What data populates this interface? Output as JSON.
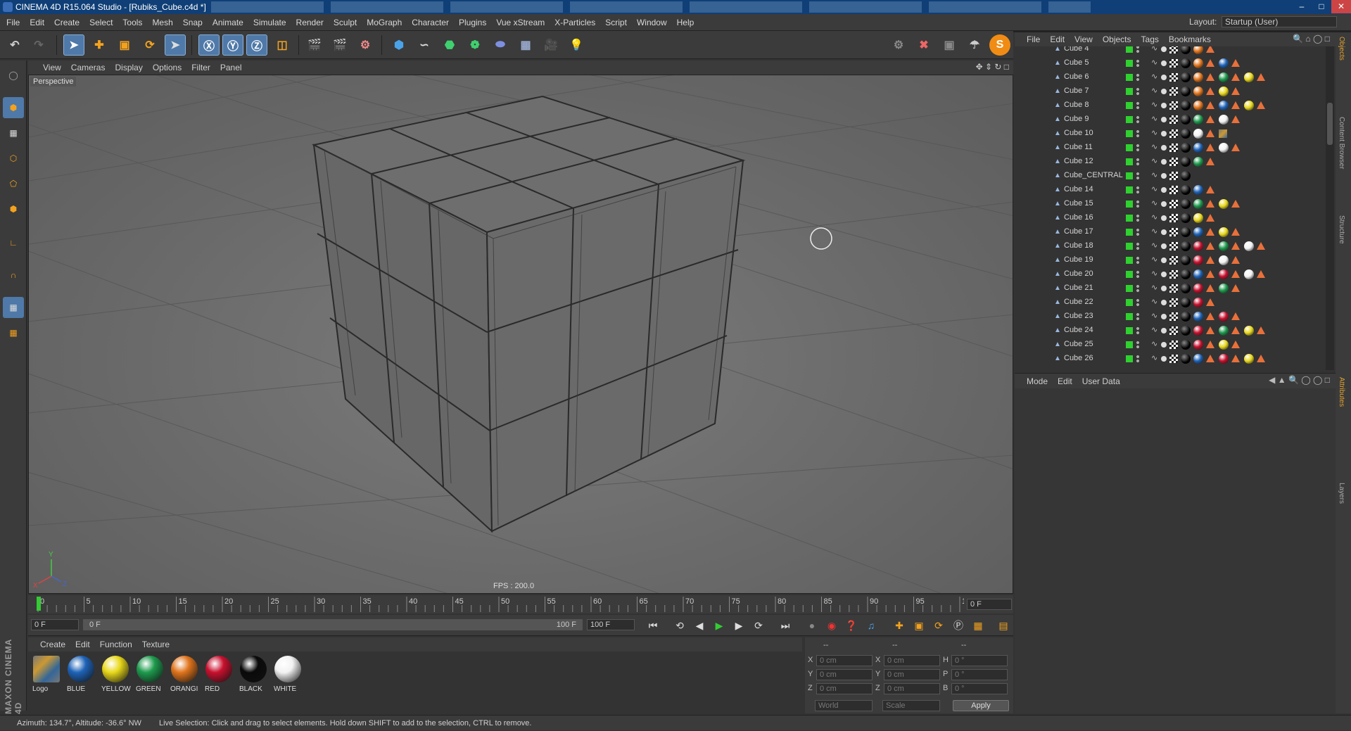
{
  "window": {
    "title": "CINEMA 4D R15.064 Studio - [Rubiks_Cube.c4d *]"
  },
  "menubar": [
    "File",
    "Edit",
    "Create",
    "Select",
    "Tools",
    "Mesh",
    "Snap",
    "Animate",
    "Simulate",
    "Render",
    "Sculpt",
    "MoGraph",
    "Character",
    "Plugins",
    "Vue xStream",
    "X-Particles",
    "Script",
    "Window",
    "Help"
  ],
  "layout": {
    "label": "Layout:",
    "value": "Startup (User)"
  },
  "viewport": {
    "menu": [
      "View",
      "Cameras",
      "Display",
      "Options",
      "Filter",
      "Panel"
    ],
    "label": "Perspective",
    "fps": "FPS : 200.0"
  },
  "timeline": {
    "ticks": [
      "0",
      "5",
      "10",
      "15",
      "20",
      "25",
      "30",
      "35",
      "40",
      "45",
      "50",
      "55",
      "60",
      "65",
      "70",
      "75",
      "80",
      "85",
      "90",
      "95",
      "100"
    ],
    "current_frame": "0 F"
  },
  "transport": {
    "start": "0 F",
    "range_start": "0 F",
    "range_end": "100 F",
    "end": "100 F"
  },
  "material_manager": {
    "menu": [
      "Create",
      "Edit",
      "Function",
      "Texture"
    ],
    "materials": [
      {
        "name": "Logo",
        "color": "#b8862b"
      },
      {
        "name": "BLUE",
        "color": "#1e63b8"
      },
      {
        "name": "YELLOW",
        "color": "#e8d81a"
      },
      {
        "name": "GREEN",
        "color": "#1d9a4d"
      },
      {
        "name": "ORANGI",
        "color": "#e0741c"
      },
      {
        "name": "RED",
        "color": "#c8102e"
      },
      {
        "name": "BLACK",
        "color": "#0a0a0a"
      },
      {
        "name": "WHITE",
        "color": "#f2f2f2"
      }
    ]
  },
  "coordinates": {
    "headers": [
      "--",
      "--",
      "--"
    ],
    "rows": [
      {
        "a": "X",
        "av": "0 cm",
        "b": "X",
        "bv": "0 cm",
        "c": "H",
        "cv": "0 °"
      },
      {
        "a": "Y",
        "av": "0 cm",
        "b": "Y",
        "bv": "0 cm",
        "c": "P",
        "cv": "0 °"
      },
      {
        "a": "Z",
        "av": "0 cm",
        "b": "Z",
        "bv": "0 cm",
        "c": "B",
        "cv": "0 °"
      }
    ],
    "world": "World",
    "scale": "Scale",
    "apply": "Apply"
  },
  "status": {
    "left": "Azimuth: 134.7°, Altitude: -36.6°  NW",
    "right": "Live Selection: Click and drag to select elements. Hold down SHIFT to add to the selection, CTRL to remove."
  },
  "object_manager": {
    "menu": [
      "File",
      "Edit",
      "View",
      "Objects",
      "Tags",
      "Bookmarks"
    ],
    "objects": [
      {
        "name": "Cube 4",
        "tags": [
          "orange"
        ]
      },
      {
        "name": "Cube 5",
        "tags": [
          "orange",
          "blue"
        ]
      },
      {
        "name": "Cube 6",
        "tags": [
          "orange",
          "green",
          "yellow"
        ]
      },
      {
        "name": "Cube 7",
        "tags": [
          "orange",
          "yellow"
        ]
      },
      {
        "name": "Cube 8",
        "tags": [
          "orange",
          "blue",
          "yellow"
        ]
      },
      {
        "name": "Cube 9",
        "tags": [
          "green",
          "white"
        ]
      },
      {
        "name": "Cube 10",
        "tags": [
          "white",
          "logo"
        ]
      },
      {
        "name": "Cube 11",
        "tags": [
          "blue",
          "white"
        ]
      },
      {
        "name": "Cube 12",
        "tags": [
          "green"
        ]
      },
      {
        "name": "Cube_CENTRAL",
        "tags": []
      },
      {
        "name": "Cube 14",
        "tags": [
          "blue"
        ]
      },
      {
        "name": "Cube 15",
        "tags": [
          "green",
          "yellow"
        ]
      },
      {
        "name": "Cube 16",
        "tags": [
          "yellow"
        ]
      },
      {
        "name": "Cube 17",
        "tags": [
          "blue",
          "yellow"
        ]
      },
      {
        "name": "Cube 18",
        "tags": [
          "red",
          "green",
          "white"
        ]
      },
      {
        "name": "Cube 19",
        "tags": [
          "red",
          "white"
        ]
      },
      {
        "name": "Cube 20",
        "tags": [
          "blue",
          "red",
          "white"
        ]
      },
      {
        "name": "Cube 21",
        "tags": [
          "red",
          "green"
        ]
      },
      {
        "name": "Cube 22",
        "tags": [
          "red"
        ]
      },
      {
        "name": "Cube 23",
        "tags": [
          "blue",
          "red"
        ]
      },
      {
        "name": "Cube 24",
        "tags": [
          "red",
          "green",
          "yellow"
        ]
      },
      {
        "name": "Cube 25",
        "tags": [
          "red",
          "yellow"
        ]
      },
      {
        "name": "Cube 26",
        "tags": [
          "blue",
          "red",
          "yellow"
        ]
      }
    ]
  },
  "attributes": {
    "menu": [
      "Mode",
      "Edit",
      "User Data"
    ]
  },
  "side_tabs": [
    "Objects",
    "Content Browser",
    "Structure",
    "Attributes",
    "Layers"
  ],
  "colors": {
    "orange": "#e0741c",
    "blue": "#1e63b8",
    "green": "#1d9a4d",
    "yellow": "#e8d81a",
    "red": "#c8102e",
    "white": "#f2f2f2",
    "black": "#0a0a0a",
    "logo": "#9a9a9a",
    "accent": "#4f79a8",
    "title": "#0f3f76"
  }
}
